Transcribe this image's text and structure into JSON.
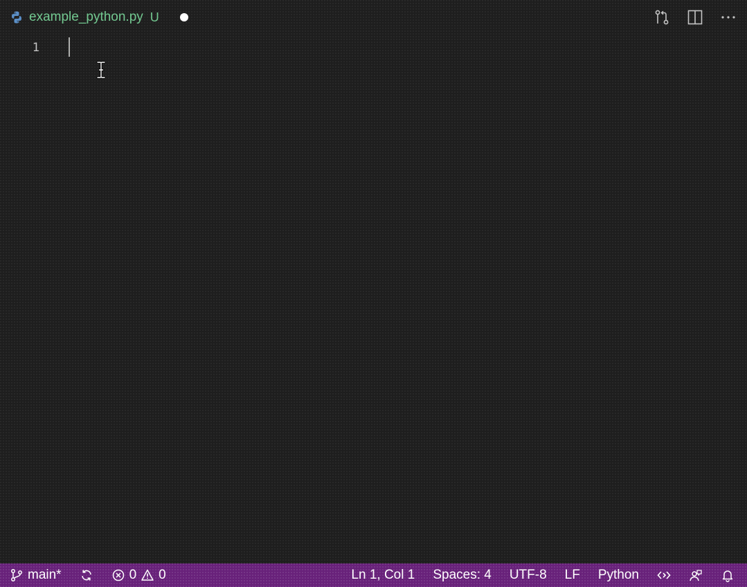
{
  "tab": {
    "filename": "example_python.py",
    "git_status": "U",
    "file_icon": "python-icon",
    "dirty_indicator": "unsaved-dot"
  },
  "tab_actions": [
    {
      "icon": "open-changes-icon"
    },
    {
      "icon": "split-editor-icon"
    },
    {
      "icon": "more-actions-icon"
    }
  ],
  "editor": {
    "line_numbers": [
      "1"
    ],
    "lines": [
      ""
    ]
  },
  "statusbar": {
    "branch": "main*",
    "problems": {
      "errors": "0",
      "warnings": "0"
    },
    "cursor": "Ln 1, Col 1",
    "indent": "Spaces: 4",
    "encoding": "UTF-8",
    "eol": "LF",
    "language": "Python"
  },
  "colors": {
    "editor_bg": "#1e1e1e",
    "statusbar_bg": "#68217a",
    "tab_name": "#73c991",
    "line_number": "#c6c6c6"
  }
}
